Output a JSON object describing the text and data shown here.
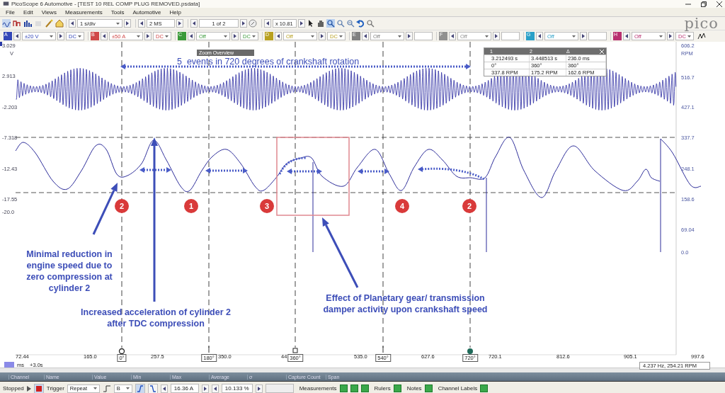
{
  "window": {
    "title": "PicoScope 6 Automotive - [TEST 10 REL COMP PLUG REMOVED.psdata]"
  },
  "menu": [
    "File",
    "Edit",
    "Views",
    "Measurements",
    "Tools",
    "Automotive",
    "Help"
  ],
  "toolbar": {
    "timebase": "1 s/div",
    "samples": "2 MS",
    "buffer": "1 of 2",
    "zoom": "x 10.81"
  },
  "logo": "pico",
  "channels": [
    {
      "letter": "A",
      "range": "±20 V",
      "coupling": "DC",
      "color": "#3346b8"
    },
    {
      "letter": "B",
      "range": "±50 A",
      "coupling": "DC",
      "color": "#d04848"
    },
    {
      "letter": "C",
      "range": "Off",
      "coupling": "DC",
      "color": "#3a9a3a"
    },
    {
      "letter": "D",
      "range": "Off",
      "coupling": "DC",
      "color": "#b8a020"
    },
    {
      "letter": "E",
      "range": "Off",
      "color": "#808080"
    },
    {
      "letter": "F",
      "range": "Off",
      "color": "#909090"
    },
    {
      "letter": "G",
      "range": "Off",
      "color": "#2aa0c8"
    },
    {
      "letter": "H",
      "range": "Off",
      "coupling": "DC",
      "color": "#b83070"
    }
  ],
  "plot": {
    "left_axis": [
      "3.029",
      "V",
      "2.913",
      "-2.203",
      "-7.318",
      "-12.43",
      "-17.55",
      "-20.0"
    ],
    "right_axis": [
      "606.2",
      "RPM",
      "516.7",
      "427.1",
      "337.7",
      "248.1",
      "158.6",
      "69.04",
      "0.0"
    ],
    "x_axis": [
      "72.44",
      "165.0",
      "257.5",
      "350.0",
      "44",
      "535.0",
      "627.6",
      "720.1",
      "812.6",
      "905.1",
      "997.6"
    ],
    "time_unit": "ms",
    "time_offset": "+3.0s",
    "readout": "4.237 Hz, 254.21 RPM",
    "rulers": [
      {
        "label": "0°",
        "kind": "hollow"
      },
      {
        "label": "180°",
        "kind": "tick"
      },
      {
        "label": "360°",
        "kind": "square"
      },
      {
        "label": "540°",
        "kind": "tick"
      },
      {
        "label": "720°",
        "kind": "filled"
      }
    ]
  },
  "zoom_overview": {
    "title": "Zoom Overview"
  },
  "ruler_table": {
    "columns": [
      "1",
      "2",
      "Δ"
    ],
    "rows": [
      [
        "3.212493 s",
        "3.448513 s",
        "236.0 ms"
      ],
      [
        "0°",
        "360°",
        "360°"
      ],
      [
        "337.8 RPM",
        "175.2 RPM",
        "162.6 RPM"
      ]
    ]
  },
  "annotations": {
    "headline": "5  events in 720 degrees of crankshaft rotation",
    "notes": [
      "Minimal reduction in engine speed due to zero compression at cylinder 2",
      "Increased acceleration of cylinder 2 after TDC compression",
      "Effect of Planetary gear/ transmission damper activity upon crankshaft speed"
    ],
    "markers": [
      "2",
      "1",
      "3",
      "4",
      "2"
    ]
  },
  "measurements": {
    "columns": [
      "Channel",
      "Name",
      "Value",
      "Min",
      "Max",
      "Average",
      "σ",
      "Capture Count",
      "Span"
    ]
  },
  "status_bar": {
    "state": "Stopped",
    "trigger_label": "Trigger",
    "trigger_mode": "Repeat",
    "trigger_channel": "B",
    "threshold": "16.36 A",
    "pre_trigger": "10.133 %",
    "toggles": [
      "Measurements",
      "Rulers",
      "Notes",
      "Channel Labels"
    ]
  }
}
